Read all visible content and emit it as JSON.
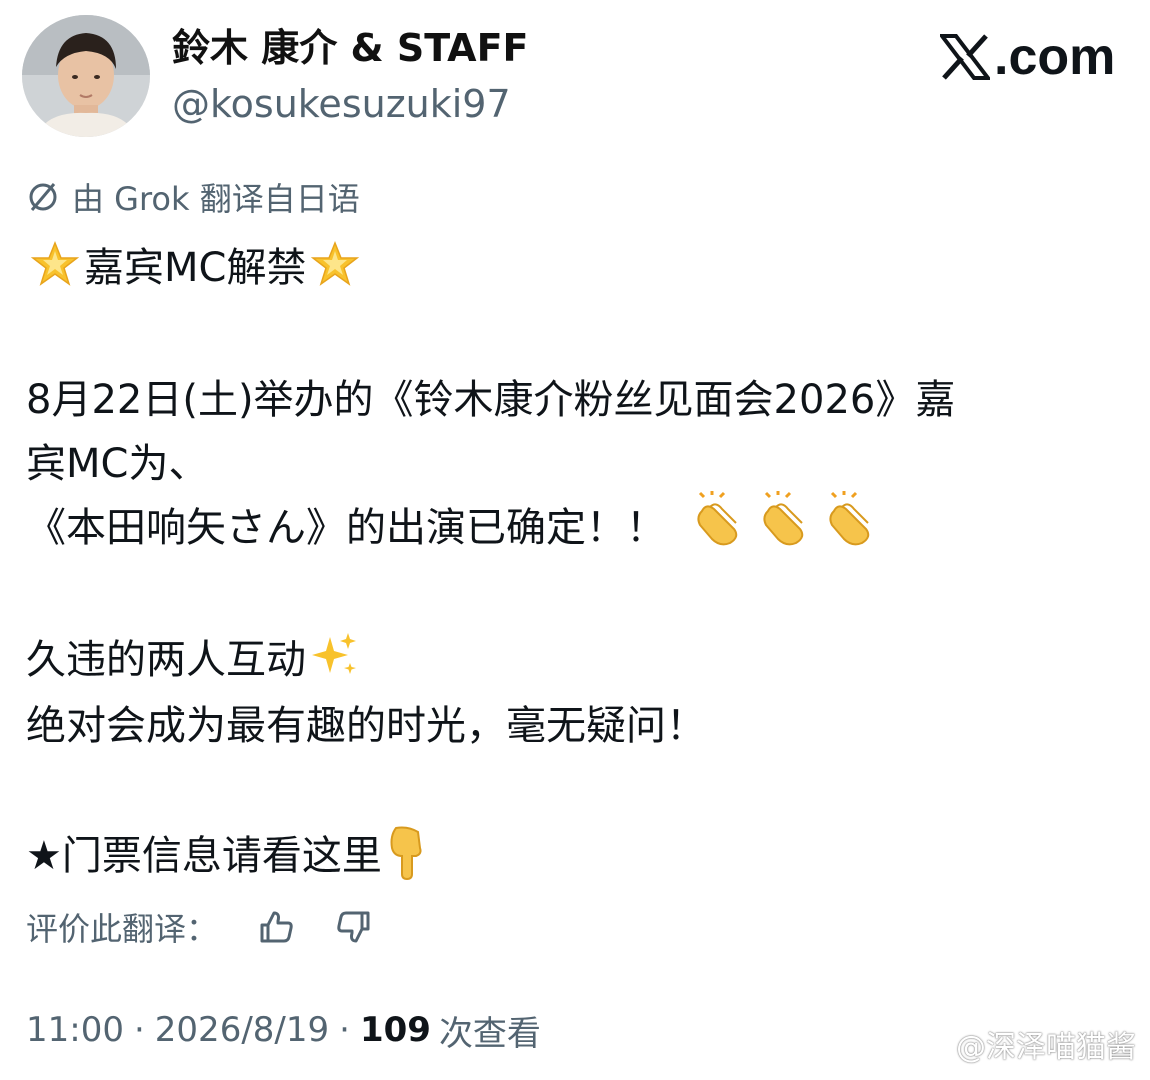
{
  "header": {
    "display_name": "鈴木 康介 & STAFF",
    "handle": "@kosukesuzuki97",
    "logo_text": ".com",
    "logo_icon": "x-logo-icon",
    "avatar_icon": "profile-avatar"
  },
  "translation_notice": {
    "icon": "translate-icon",
    "text": "由 Grok 翻译自日语"
  },
  "tweet": {
    "title": "嘉宾MC解禁",
    "title_emoji": "glowing-star",
    "para1_line1": "8月22日(土)举办的《铃木康介粉丝见面会2026》嘉",
    "para1_line2": "宾MC为、",
    "para1_line3": "《本田响矢さん》的出演已确定！！",
    "para1_emoji": "clapping-hands",
    "para2_line1": "久违的两人互动",
    "para2_emoji": "sparkles",
    "para2_line2": "绝对会成为最有趣的时光，毫无疑问！",
    "para3_line1": "★门票信息请看这里",
    "para3_emoji": "pointing-down"
  },
  "rating": {
    "label": "评价此翻译：",
    "up_icon": "thumbs-up-icon",
    "down_icon": "thumbs-down-icon"
  },
  "meta": {
    "time": "11:00",
    "separator": "·",
    "date": "2026/8/19",
    "views_count": "109",
    "views_label": "次查看"
  },
  "watermark": {
    "text": "@深泽喵猫酱",
    "icon": "weibo-icon"
  },
  "colors": {
    "text_primary": "#0f1419",
    "text_secondary": "#536471",
    "background": "#ffffff",
    "star_yellow": "#f8c22c",
    "clap_yellow": "#f6c44b"
  }
}
